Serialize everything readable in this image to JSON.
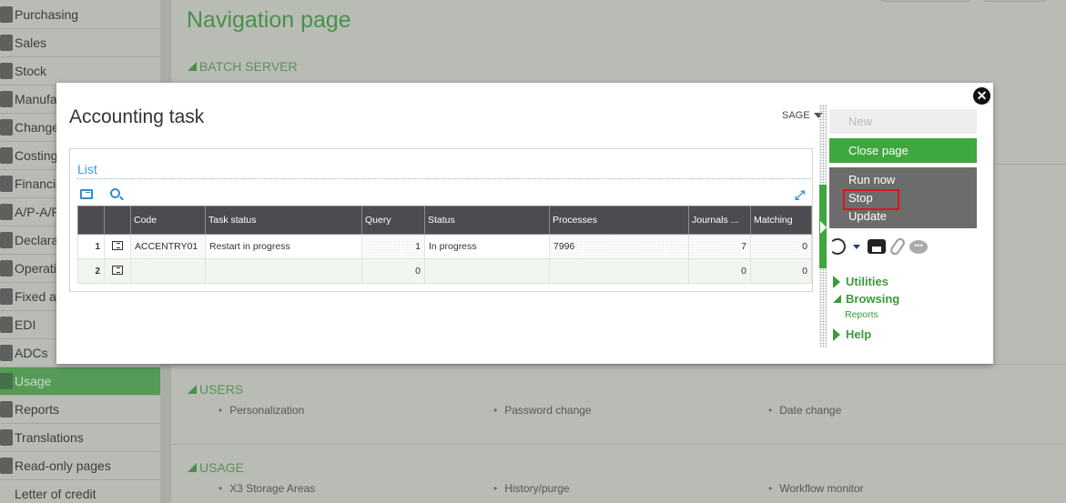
{
  "sidebar": {
    "items": [
      {
        "label": "Purchasing",
        "icon": "purchasing-icon",
        "active": false
      },
      {
        "label": "Sales",
        "icon": "sales-icon",
        "active": false
      },
      {
        "label": "Stock",
        "icon": "stock-icon",
        "active": false
      },
      {
        "label": "Manufacturing",
        "icon": "manufacturing-icon",
        "active": false
      },
      {
        "label": "Change management",
        "icon": "gear-icon",
        "active": false
      },
      {
        "label": "Costing",
        "icon": "costing-icon",
        "active": false
      },
      {
        "label": "Financials",
        "icon": "calculator-icon",
        "active": false
      },
      {
        "label": "A/P-A/R accounting",
        "icon": "calendar-icon",
        "active": false
      },
      {
        "label": "Declarations",
        "icon": "bank-icon",
        "active": false
      },
      {
        "label": "Operating",
        "icon": "operating-icon",
        "active": false
      },
      {
        "label": "Fixed assets",
        "icon": "monitor-icon",
        "active": false
      },
      {
        "label": "EDI",
        "icon": "edi-icon",
        "active": false
      },
      {
        "label": "ADCs",
        "icon": "tablet-icon",
        "active": false
      },
      {
        "label": "Usage",
        "icon": "server-icon",
        "active": true
      },
      {
        "label": "Reports",
        "icon": "printer-icon",
        "active": false
      },
      {
        "label": "Translations",
        "icon": "translation-icon",
        "active": false
      },
      {
        "label": "Read-only pages",
        "icon": "read-only-icon",
        "active": false
      },
      {
        "label": "Letter of credit",
        "icon": "",
        "active": false
      }
    ]
  },
  "page": {
    "title": "Navigation page",
    "sections": [
      {
        "title": "BATCH SERVER",
        "items": []
      },
      {
        "title": "USERS",
        "items": [
          "Personalization",
          "Password change",
          "Date change"
        ]
      },
      {
        "title": "USAGE",
        "items": [
          "X3 Storage Areas",
          "History/purge",
          "Workflow monitor"
        ]
      }
    ]
  },
  "modal": {
    "title": "Accounting task",
    "user_menu": "SAGE",
    "close_icon": "close-icon",
    "list": {
      "title": "List",
      "columns": [
        "Code",
        "Task status",
        "Query",
        "Status",
        "Processes",
        "Journals ...",
        "Matching"
      ],
      "rows": [
        {
          "num": "1",
          "code": "ACCENTRY01",
          "task_status": "Restart in progress",
          "query": "1",
          "status": "In progress",
          "processes": "7996",
          "journals": "7",
          "matching": "0"
        },
        {
          "num": "2",
          "code": "",
          "task_status": "",
          "query": "0",
          "status": "",
          "processes": "",
          "journals": "0",
          "matching": "0"
        }
      ]
    },
    "actions": {
      "new": "New",
      "close_page": "Close page",
      "run_now": "Run now",
      "stop": "Stop",
      "update": "Update"
    },
    "nav": {
      "utilities": "Utilities",
      "browsing": "Browsing",
      "reports": "Reports",
      "help": "Help"
    },
    "colors": {
      "accent_green": "#3ea73e",
      "highlight_red": "#e0141e",
      "link_blue": "#3b9bd6"
    }
  }
}
